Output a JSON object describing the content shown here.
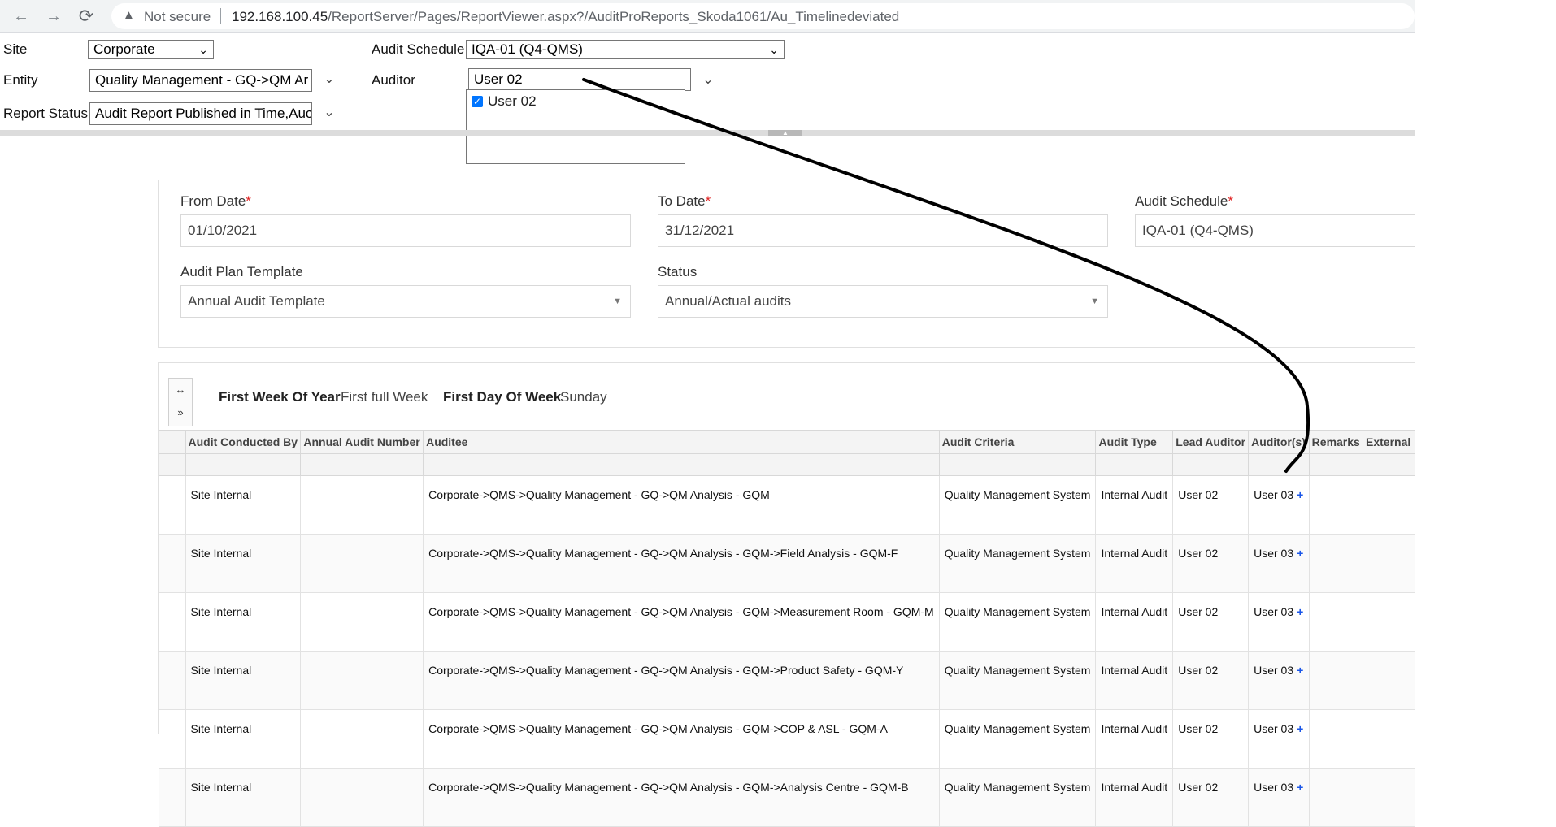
{
  "browser": {
    "not_secure": "Not secure",
    "url_host": "192.168.100.45",
    "url_path": "/ReportServer/Pages/ReportViewer.aspx?/AuditProReports_Skoda1061/Au_Timelinedeviated"
  },
  "params": {
    "site_label": "Site",
    "site_value": "Corporate",
    "entity_label": "Entity",
    "entity_value": "Quality Management - GQ->QM Ar",
    "report_status_label": "Report Status",
    "report_status_value": "Audit Report Published in Time,Auc",
    "audit_schedule_label": "Audit Schedule",
    "audit_schedule_value": "IQA-01 (Q4-QMS)",
    "auditor_label": "Auditor",
    "auditor_value": "User 02",
    "auditor_option": "User 02"
  },
  "form": {
    "from_date_label": "From Date",
    "from_date_value": "01/10/2021",
    "to_date_label": "To Date",
    "to_date_value": "31/12/2021",
    "audit_schedule_label": "Audit Schedule",
    "audit_schedule_value": "IQA-01 (Q4-QMS)",
    "template_label": "Audit Plan Template",
    "template_value": "Annual Audit Template",
    "status_label": "Status",
    "status_value": "Annual/Actual audits",
    "required_mark": "*"
  },
  "grid": {
    "expand_glyph": "↔",
    "next_glyph": "»",
    "first_week_label": "First Week Of Year",
    "first_week_value": "First full Week",
    "first_day_label": "First Day Of Week",
    "first_day_value": "Sunday",
    "columns": [
      "Audit Conducted By",
      "Annual Audit Number",
      "Auditee",
      "Audit Criteria",
      "Audit Type",
      "Lead Auditor",
      "Auditor(s)",
      "Remarks",
      "External"
    ],
    "rows": [
      {
        "conducted_by": "Site Internal",
        "annual_number": "",
        "auditee": "Corporate->QMS->Quality Management - GQ->QM Analysis - GQM",
        "criteria": "Quality Management System",
        "type": "Internal Audit",
        "lead": "User 02",
        "auditors": "User 03",
        "plus": "+"
      },
      {
        "conducted_by": "Site Internal",
        "annual_number": "",
        "auditee": "Corporate->QMS->Quality Management - GQ->QM Analysis - GQM->Field Analysis - GQM-F",
        "criteria": "Quality Management System",
        "type": "Internal Audit",
        "lead": "User 02",
        "auditors": "User 03",
        "plus": "+"
      },
      {
        "conducted_by": "Site Internal",
        "annual_number": "",
        "auditee": "Corporate->QMS->Quality Management - GQ->QM Analysis - GQM->Measurement Room - GQM-M",
        "criteria": "Quality Management System",
        "type": "Internal Audit",
        "lead": "User 02",
        "auditors": "User 03",
        "plus": "+"
      },
      {
        "conducted_by": "Site Internal",
        "annual_number": "",
        "auditee": "Corporate->QMS->Quality Management - GQ->QM Analysis - GQM->Product Safety - GQM-Y",
        "criteria": "Quality Management System",
        "type": "Internal Audit",
        "lead": "User 02",
        "auditors": "User 03",
        "plus": "+"
      },
      {
        "conducted_by": "Site Internal",
        "annual_number": "",
        "auditee": "Corporate->QMS->Quality Management - GQ->QM Analysis - GQM->COP & ASL - GQM-A",
        "criteria": "Quality Management System",
        "type": "Internal Audit",
        "lead": "User 02",
        "auditors": "User 03",
        "plus": "+"
      },
      {
        "conducted_by": "Site Internal",
        "annual_number": "",
        "auditee": "Corporate->QMS->Quality Management - GQ->QM Analysis - GQM->Analysis Centre - GQM-B",
        "criteria": "Quality Management System",
        "type": "Internal Audit",
        "lead": "User 02",
        "auditors": "User 03",
        "plus": "+"
      }
    ]
  },
  "colors": {
    "required": "#e02020",
    "plus": "#1a56e8",
    "checkbox": "#0075ff"
  }
}
